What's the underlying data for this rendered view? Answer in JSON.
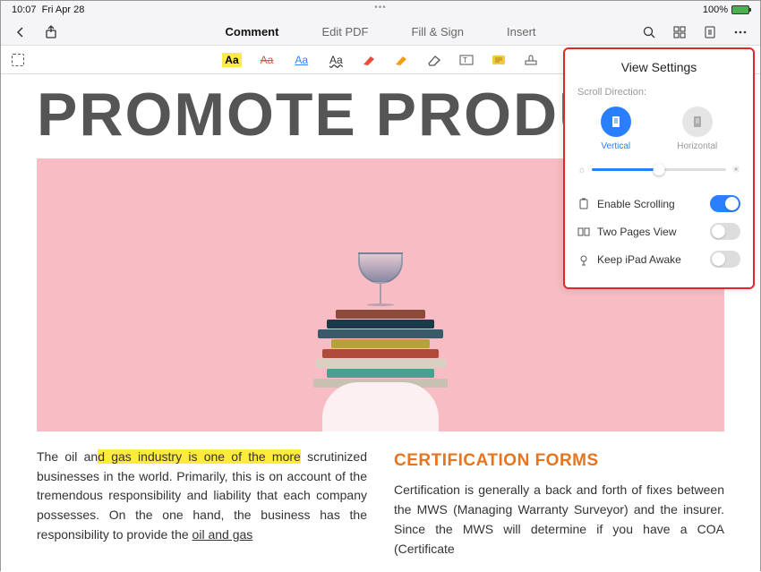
{
  "statusbar": {
    "time": "10:07",
    "date": "Fri Apr 28",
    "battery": "100%"
  },
  "topnav": {
    "tabs": [
      {
        "label": "Comment",
        "active": true
      },
      {
        "label": "Edit PDF",
        "active": false
      },
      {
        "label": "Fill & Sign",
        "active": false
      },
      {
        "label": "Insert",
        "active": false
      }
    ]
  },
  "toolbar": {
    "aa_highlight": "Aa",
    "aa_strike": "Aa",
    "aa_underline": "Aa",
    "aa_squiggle": "Aa"
  },
  "document": {
    "big_title": "PROMOTE PRODUCT",
    "col1_text_a": "The oil an",
    "col1_text_hl": "d gas industry is one of the more",
    "col1_text_b": " scrutinized businesses in the world. Primarily, this is on account of the tremendous responsibility and liability that each company possesses. On the one hand, the business has the responsibility to provide the ",
    "col1_text_ul": "oil and gas",
    "col2_heading": "CERTIFICATION FORMS",
    "col2_text": "Certification is generally a back and forth of fixes between the MWS (Managing Warranty Surveyor) and the insurer. Since the MWS will determine if you have a COA (Certificate"
  },
  "view_settings": {
    "title": "View Settings",
    "scroll_label": "Scroll Direction:",
    "vertical": "Vertical",
    "horizontal": "Horizontal",
    "enable_scrolling": "Enable Scrolling",
    "two_pages": "Two Pages View",
    "keep_awake": "Keep iPad Awake",
    "toggles": {
      "scrolling": true,
      "twopages": false,
      "awake": false
    }
  }
}
